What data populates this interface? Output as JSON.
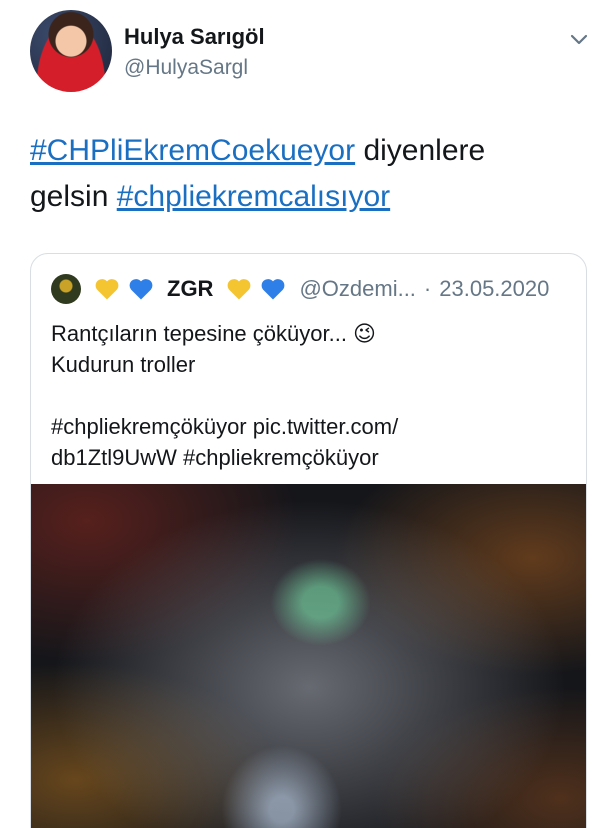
{
  "author": {
    "name": "Hulya Sarıgöl",
    "handle": "@HulyaSargl",
    "avatar_icon": "profile-photo",
    "menu_icon": "chevron-down-icon"
  },
  "tweet": {
    "hashtag1": "#CHPliEkremCoekueyor",
    "text1": " diyenlere",
    "text2": "gelsin ",
    "hashtag2": "#chpliekremcalısıyor"
  },
  "quote": {
    "name": "ZGR",
    "handle": "@Ozdemi...",
    "separator": "·",
    "date": "23.05.2020",
    "line1": "Rantçıların tepesine çöküyor... 😉",
    "line2": "Kudurun troller",
    "line3": "#chpliekremçöküyor pic.twitter.com/",
    "line4": "db1Ztl9UwW #chpliekremçöküyor",
    "media_description_icon": "crowd-night-aerial-photo"
  },
  "colors": {
    "link": "#1b6fc2",
    "secondary_text": "#657786",
    "heart_yellow": "#f4c531",
    "heart_blue": "#2f7fe8"
  }
}
